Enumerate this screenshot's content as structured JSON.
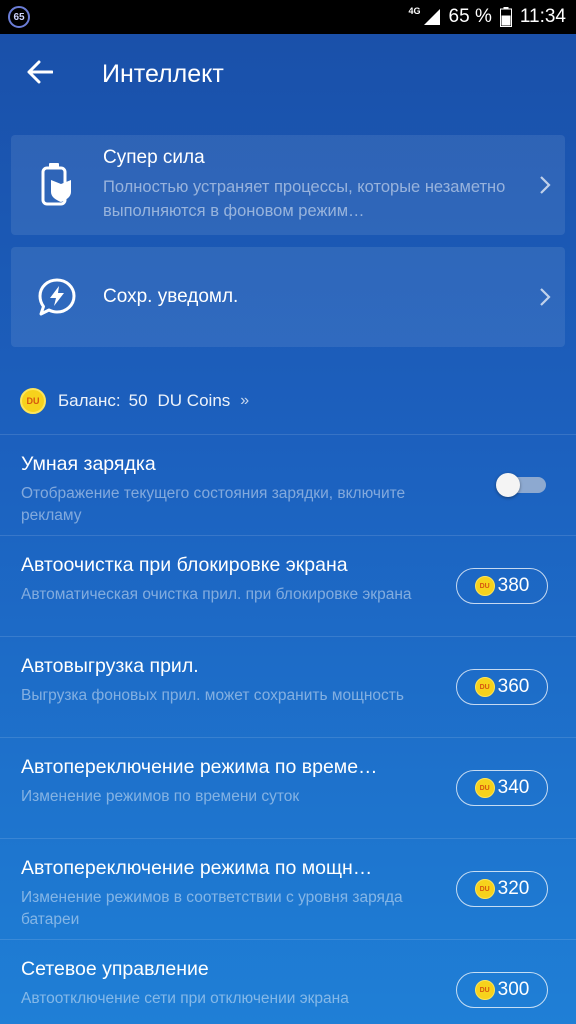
{
  "status_bar": {
    "badge": "65",
    "network": "4G",
    "battery": "65 %",
    "time": "11:34"
  },
  "header": {
    "title": "Интеллект"
  },
  "cards": [
    {
      "title": "Супер сила",
      "desc": "Полностью устраняет процессы, которые незаметно выполняются в фоновом режим…",
      "icon": "battery-shield-icon"
    },
    {
      "title": "Сохр. уведомл.",
      "icon": "lightning-chat-icon"
    }
  ],
  "balance": {
    "coin_label": "DU",
    "label": "Баланс:",
    "value": "50",
    "unit": "DU Coins",
    "arrow": "»"
  },
  "features": [
    {
      "title": "Умная зарядка",
      "desc": "Отображение текущего состояния зарядки, включите рекламу",
      "toggle_on": false
    },
    {
      "title": "Автоочистка при блокировке экрана",
      "desc": "Автоматическая очистка прил. при блокировке экрана",
      "price": "380"
    },
    {
      "title": "Автовыгрузка прил.",
      "desc": "Выгрузка фоновых прил. может сохранить мощность",
      "price": "360"
    },
    {
      "title": "Автопереключение режима по време…",
      "desc": "Изменение режимов по времени суток",
      "price": "340"
    },
    {
      "title": "Автопереключение режима по мощн…",
      "desc": "Изменение режимов в соответствии с уровня заряда батареи",
      "price": "320"
    },
    {
      "title": "Сетевое управление",
      "desc": "Автоотключение сети при отключении экрана",
      "price": "300"
    }
  ],
  "colors": {
    "background_top": "#1a4fa8",
    "background_bottom": "#1f7fd6",
    "coin": "#f7d21c"
  }
}
